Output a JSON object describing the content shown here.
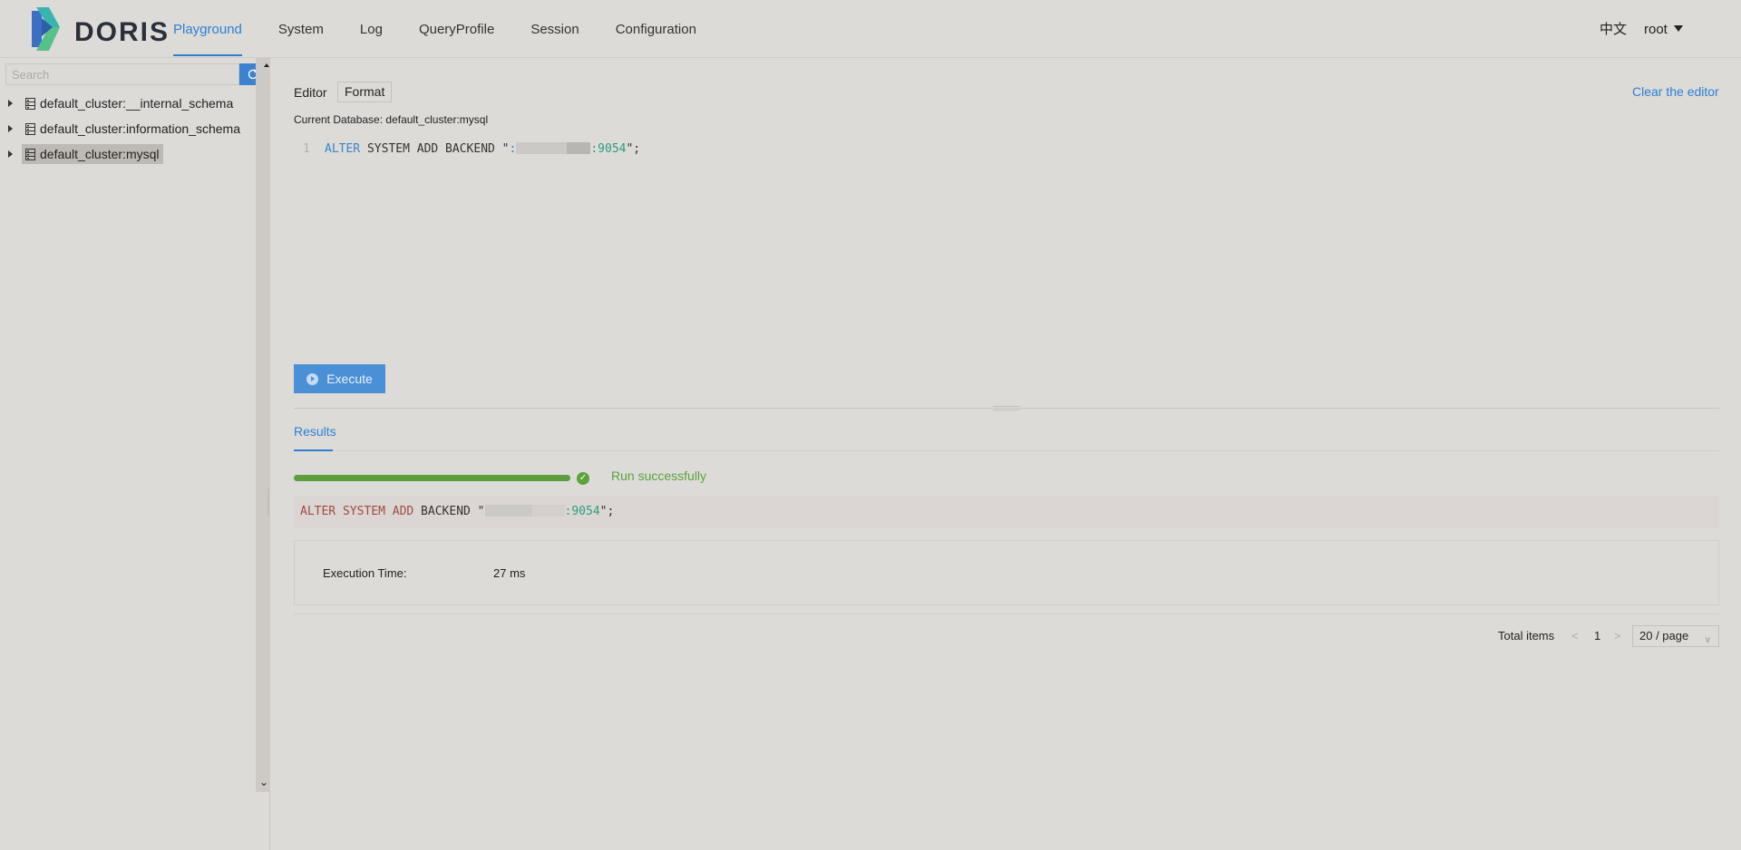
{
  "app": {
    "name": "DORIS",
    "colors": {
      "accent": "#2d7fd2",
      "success": "#5aa33b",
      "logo_blue": "#3b6fc4",
      "logo_teal": "#39b5b0",
      "logo_green": "#58c08a"
    }
  },
  "nav": {
    "items": [
      "Playground",
      "System",
      "Log",
      "QueryProfile",
      "Session",
      "Configuration"
    ],
    "active": "Playground"
  },
  "header": {
    "language": "中文",
    "user": "root"
  },
  "sidebar": {
    "search_placeholder": "Search",
    "refresh_icon": "refresh-icon",
    "databases": [
      {
        "label": "default_cluster:__internal_schema",
        "selected": false
      },
      {
        "label": "default_cluster:information_schema",
        "selected": false
      },
      {
        "label": "default_cluster:mysql",
        "selected": true
      }
    ]
  },
  "editor": {
    "label": "Editor",
    "format_label": "Format",
    "clear_label": "Clear the editor",
    "current_database_label": "Current Database:",
    "current_database": "default_cluster:mysql",
    "line_number": "1",
    "sql_keyword": "ALTER",
    "sql_rest": " SYSTEM ADD BACKEND \"",
    "sql_host_prefix": ":",
    "sql_port": ":9054",
    "sql_end": "\";"
  },
  "execute": {
    "label": "Execute"
  },
  "results": {
    "tab_label": "Results",
    "progress_percent": 100,
    "status": "Run successfully",
    "sql_keywords": "ALTER SYSTEM ADD",
    "sql_rest": " BACKEND \"",
    "sql_port": ":9054",
    "sql_end": "\";",
    "execution_time_label": "Execution Time:",
    "execution_time_value": "27 ms"
  },
  "pagination": {
    "total_label": "Total items",
    "prev_icon": "chevron-left-icon",
    "current_page": "1",
    "next_icon": "chevron-right-icon",
    "page_size": "20 / page"
  }
}
